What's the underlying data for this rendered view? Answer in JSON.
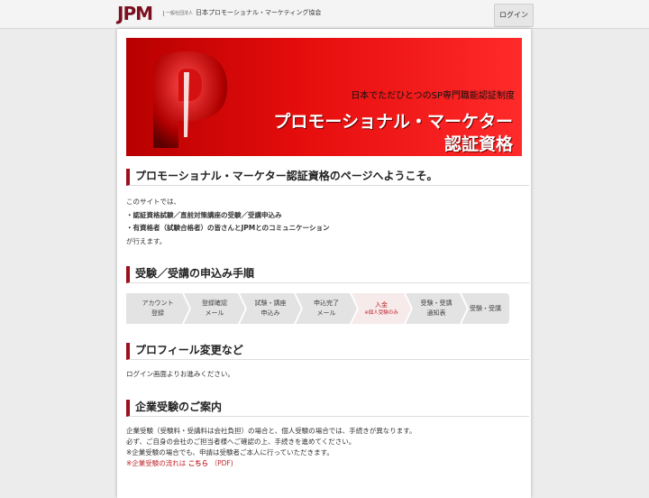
{
  "header": {
    "logo": "JPM",
    "org_small": "一般社団法人",
    "org_name": "日本プロモーショナル・マーケティング協会",
    "login_label": "ログイン"
  },
  "hero": {
    "subtitle": "日本でただひとつのSP専門職能認証制度",
    "title_line1": "プロモーショナル・マーケター",
    "title_line2": "認証資格"
  },
  "welcome": {
    "heading": "プロモーショナル・マーケター認証資格のページへようこそ。",
    "lines": [
      "このサイトでは、",
      "・認証資格試験／直前対策講座の受験／受講申込み",
      "・有資格者（試験合格者）の皆さんとJPMとのコミュニケーション",
      "が行えます。"
    ]
  },
  "procedure": {
    "heading": "受験／受講の申込み手順",
    "steps": [
      {
        "line1": "アカウント",
        "line2": "登録",
        "note": ""
      },
      {
        "line1": "登録確認",
        "line2": "メール",
        "note": ""
      },
      {
        "line1": "試験・講座",
        "line2": "申込み",
        "note": ""
      },
      {
        "line1": "申込完了",
        "line2": "メール",
        "note": ""
      },
      {
        "line1": "入金",
        "line2": "",
        "note": "※個人受験のみ"
      },
      {
        "line1": "受験・受講",
        "line2": "通知表",
        "note": ""
      },
      {
        "line1": "受験・受講",
        "line2": "",
        "note": ""
      }
    ]
  },
  "profile": {
    "heading": "プロフィール変更など",
    "text": "ログイン画面よりお進みください。"
  },
  "corporate": {
    "heading": "企業受験のご案内",
    "line1": "企業受験（受験料・受講料は会社負担）の場合と、個人受験の場合では、手続きが異なります。",
    "line2": "必ず、ご自身の会社のご担当者様へご確認の上、手続きを進めてください。",
    "line3": "※企業受験の場合でも、申請は受験者ご本人に行っていただきます。",
    "line4_prefix": "※企業受験の流れは",
    "line4_link": "こちら",
    "line4_suffix": "（PDF)"
  }
}
